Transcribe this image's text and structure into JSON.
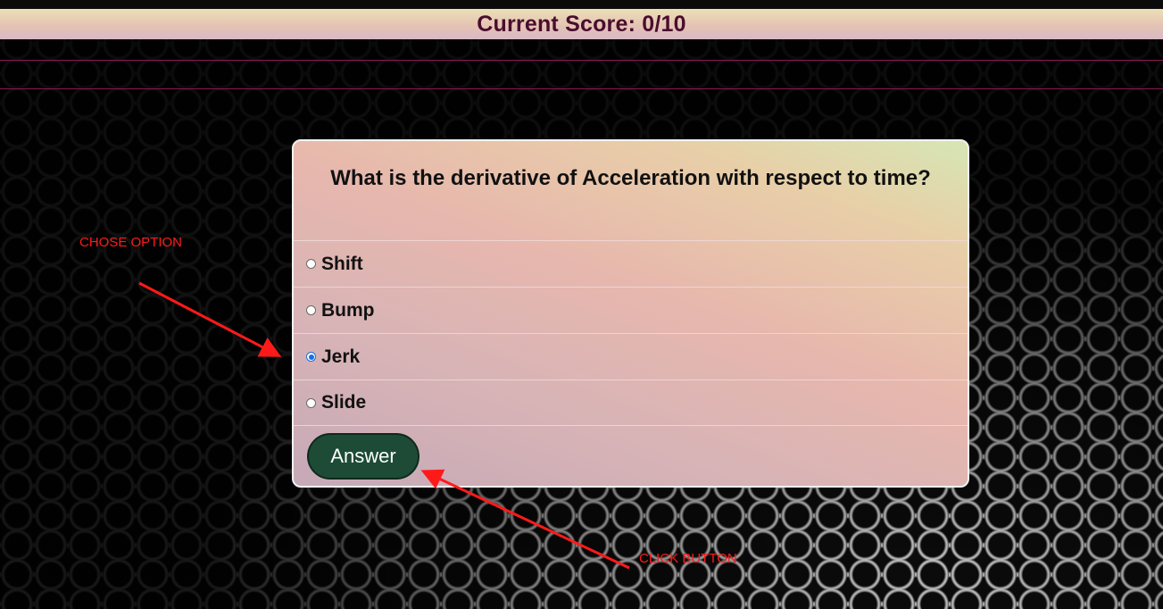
{
  "score": {
    "label": "Current Score: 0/10"
  },
  "quiz": {
    "question": "What is the derivative of Acceleration with respect to time?",
    "options": [
      {
        "label": "Shift",
        "selected": false
      },
      {
        "label": "Bump",
        "selected": false
      },
      {
        "label": "Jerk",
        "selected": true
      },
      {
        "label": "Slide",
        "selected": false
      }
    ],
    "answer_button_label": "Answer"
  },
  "annotations": {
    "choose_option": "CHOSE OPTION",
    "click_button": "CLICK BUTTON"
  },
  "colors": {
    "score_text": "#4a0d2e",
    "annotation": "#ff1a1a",
    "answer_button": "#1d4b36",
    "radio_checked": "#1a6fe0"
  }
}
